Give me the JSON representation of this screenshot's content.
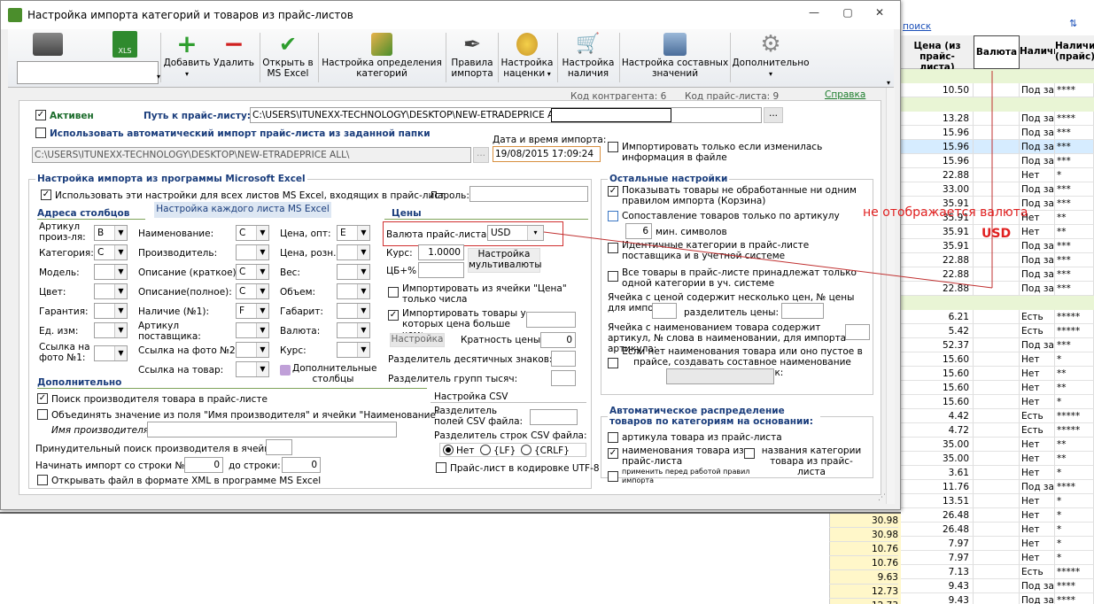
{
  "window": {
    "title": "Настройка импорта категорий и товаров из прайс-листов"
  },
  "toolbar": {
    "add": "Добавить",
    "delete": "Удалить",
    "open_excel": "Открыть в MS Excel",
    "category_setup": "Настройка определения категорий",
    "import_rules": "Правила импорта",
    "markup_setup": "Настройка наценки",
    "availability_setup": "Настройка наличия",
    "composite_values": "Настройка составных значений",
    "additional": "Дополнительно"
  },
  "info": {
    "contractor_code": "Код контрагента: 6",
    "pricelist_code": "Код прайс-листа: 9",
    "help": "Справка"
  },
  "main": {
    "active": "Активен",
    "path_label": "Путь к прайс-листу:",
    "path_value": "C:\\USERS\\ITUNEXX-TECHNOLOGY\\DESKTOP\\NEW-ETRADEPRICE ALL\\",
    "auto_import": "Использовать автоматический импорт прайс-листа из заданной папки",
    "auto_path": "C:\\USERS\\ITUNEXX-TECHNOLOGY\\DESKTOP\\NEW-ETRADEPRICE ALL\\",
    "datetime_label": "Дата и время импорта:",
    "datetime_value": "19/08/2015 17:09:24",
    "only_if_changed": "Импортировать только если изменилась информация в файле"
  },
  "excel": {
    "title": "Настройка импорта из программы Microsoft Excel",
    "use_all": "Использовать эти настройки для всех листов MS Excel, входящих в прайс-лист",
    "password": "Пароль:",
    "each_sheet": "Настройка каждого листа MS Excel",
    "columns_title": "Адреса столбцов",
    "article": "Артикул произ-ля:",
    "article_v": "B",
    "category": "Категория:",
    "category_v": "C",
    "model": "Модель:",
    "color": "Цвет:",
    "warranty": "Гарантия:",
    "unit": "Ед. изм:",
    "photo1": "Ссылка на фото №1:",
    "name": "Наименование:",
    "name_v": "C",
    "manufacturer": "Производитель:",
    "desc_short": "Описание (краткое):",
    "desc_short_v": "C",
    "desc_full": "Описание(полное):",
    "desc_full_v": "C",
    "avail1": "Наличие (№1):",
    "avail1_v": "F",
    "supplier_article": "Артикул поставщика:",
    "photo2": "Ссылка на фото №2:",
    "product_link": "Ссылка на товар:",
    "price_wholesale": "Цена, опт:",
    "price_wholesale_v": "E",
    "price_retail": "Цена, розн.:",
    "weight": "Вес:",
    "volume": "Объем:",
    "dimensions": "Габарит:",
    "currency": "Валюта:",
    "rate": "Курс:",
    "extra_columns": "Дополнительные столбцы"
  },
  "prices": {
    "title": "Цены",
    "currency_label": "Валюта прайс-листа:",
    "currency_value": "USD",
    "rate_label": "Курс:",
    "rate_value": "1.0000",
    "cb_label": "ЦБ+%",
    "multi_currency": "Настройка мультивалюты",
    "import_price_cell": "Импортировать из ячейки \"Цена\" только числа",
    "import_price_gt": "Импортировать товары у которых цена больше чем:",
    "setup": "Настройка",
    "price_multiple": "Кратность цены:",
    "price_multiple_v": "0",
    "decimal_sep": "Разделитель десятичных знаков:",
    "thousand_sep": "Разделитель групп тысяч:"
  },
  "additional": {
    "title": "Дополнительно",
    "find_manufacturer": "Поиск производителя товара в прайс-листе",
    "merge_values": "Объединять значение из поля \"Имя производителя\" и ячейки \"Наименование\"",
    "manufacturer_name": "Имя производителя:",
    "forced_search": "Принудительный поиск производителя в ячейке:",
    "start_row": "Начинать импорт со строки №:",
    "start_row_v": "0",
    "to_row": "до строки:",
    "to_row_v": "0",
    "open_xml": "Открывать файл в формате XML в программе MS Excel"
  },
  "csv": {
    "title": "Настройка CSV",
    "field_sep": "Разделитель полей CSV файла:",
    "row_sep": "Разделитель строк CSV файла:",
    "opt_none": "Нет",
    "opt_lf": "{LF}",
    "opt_crlf": "{CRLF}",
    "utf8": "Прайс-лист в кодировке UTF-8"
  },
  "other": {
    "title": "Остальные настройки",
    "show_unprocessed": "Показывать товары не обработанные ни одним правилом импорта (Корзина)",
    "match_article": "Сопоставление товаров только по артикулу",
    "min_chars_v": "6",
    "min_chars": "мин. символов",
    "identical_cats": "Идентичные категории в прайс-листе поставщика и в учетной системе",
    "all_one_cat": "Все товары в прайс-листе принадлежат только одной категории в уч. системе",
    "multi_price": "Ячейка с ценой содержит несколько цен, № цены для импорта:",
    "price_sep": "разделитель цены:",
    "article_in_name": "Ячейка с наименованием товара содержит артикул, № слова в наименовании, для импорта артикула:",
    "no_name": "Если нет наименования товара или оно пустое в прайсе, создавать составное наименование товара из ячеек:"
  },
  "auto_dist": {
    "title": "Автоматическое распределение товаров по категориям на основании:",
    "by_article": "артикула товара из прайс-листа",
    "by_name": "наименования товара из прайс-листа",
    "by_cat_names": "названия категории товара из прайс-листа",
    "apply_rules": "применить перед работой правил импорта"
  },
  "annotation": {
    "text": "не отображается валюта",
    "currency": "USD"
  },
  "bg": {
    "search": "поиск",
    "col_price": "Цена (из прайс-листа)",
    "col_currency": "Валюта",
    "col_avail": "Наличи",
    "col_avail2": "Наличие (прайс)",
    "rows": [
      {
        "p": "10.50",
        "a": "Под зак",
        "s": "****"
      },
      {
        "p": "13.28",
        "a": "Под зак",
        "s": "****"
      },
      {
        "p": "15.96",
        "a": "Под зак",
        "s": "***"
      },
      {
        "p": "15.96",
        "a": "Под зак",
        "s": "***"
      },
      {
        "p": "15.96",
        "a": "Под зак",
        "s": "***"
      },
      {
        "p": "22.88",
        "a": "Нет",
        "s": "*"
      },
      {
        "p": "33.00",
        "a": "Под зак",
        "s": "***"
      },
      {
        "p": "35.91",
        "a": "Под зак",
        "s": "***"
      },
      {
        "p": "35.91",
        "a": "Нет",
        "s": "**"
      },
      {
        "p": "35.91",
        "a": "Нет",
        "s": "**"
      },
      {
        "p": "35.91",
        "a": "Под зак",
        "s": "***"
      },
      {
        "p": "22.88",
        "a": "Под зак",
        "s": "***"
      },
      {
        "p": "22.88",
        "a": "Под зак",
        "s": "***"
      },
      {
        "p": "22.88",
        "a": "Под зак",
        "s": "***"
      },
      {
        "p": "6.21",
        "a": "Есть",
        "s": "*****"
      },
      {
        "p": "5.42",
        "a": "Есть",
        "s": "*****"
      },
      {
        "p": "52.37",
        "a": "Под зак",
        "s": "***"
      },
      {
        "p": "15.60",
        "a": "Нет",
        "s": "*"
      },
      {
        "p": "15.60",
        "a": "Нет",
        "s": "**"
      },
      {
        "p": "15.60",
        "a": "Нет",
        "s": "**"
      },
      {
        "p": "15.60",
        "a": "Нет",
        "s": "*"
      },
      {
        "p": "4.42",
        "a": "Есть",
        "s": "*****"
      },
      {
        "p": "4.72",
        "a": "Есть",
        "s": "*****"
      },
      {
        "p": "35.00",
        "a": "Нет",
        "s": "**"
      },
      {
        "p": "35.00",
        "a": "Нет",
        "s": "**"
      },
      {
        "p": "3.61",
        "a": "Нет",
        "s": "*"
      },
      {
        "p": "11.76",
        "a": "Под зак",
        "s": "****"
      },
      {
        "p": "13.51",
        "a": "Нет",
        "s": "*"
      },
      {
        "p": "26.48",
        "a": "Нет",
        "s": "*"
      },
      {
        "p": "26.48",
        "a": "Нет",
        "s": "*"
      },
      {
        "p": "7.97",
        "a": "Нет",
        "s": "*"
      },
      {
        "p": "7.97",
        "a": "Нет",
        "s": "*"
      },
      {
        "p": "7.13",
        "a": "Есть",
        "s": "*****"
      },
      {
        "p": "9.43",
        "a": "Под зак",
        "s": "****"
      },
      {
        "p": "9.43",
        "a": "Под зак",
        "s": "****"
      }
    ],
    "left_vals": [
      "30.98",
      "30.98",
      "10.76",
      "10.76",
      "9.63",
      "12.73",
      "12.73"
    ]
  }
}
